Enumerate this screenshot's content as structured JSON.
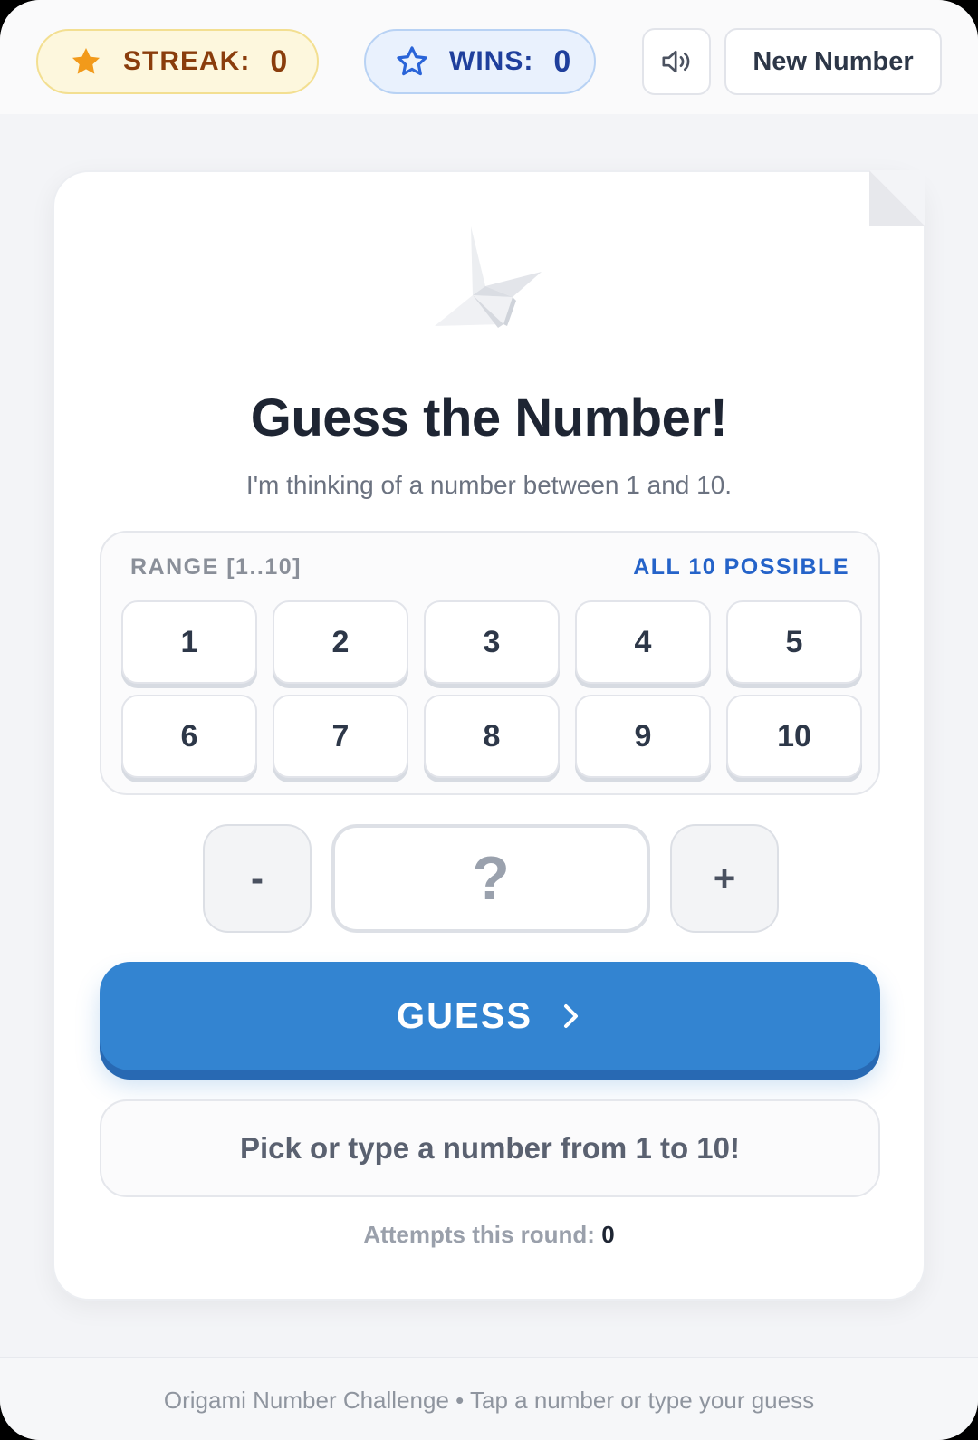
{
  "header": {
    "streak": {
      "label": "STREAK:",
      "value": "0",
      "icon": "star-filled-icon",
      "color": "#f29a1a"
    },
    "wins": {
      "label": "WINS:",
      "value": "0",
      "icon": "star-outline-icon",
      "color": "#2a64d8"
    },
    "sound_icon": "speaker-icon",
    "new_number_label": "New Number"
  },
  "game": {
    "title": "Guess the Number!",
    "subtitle": "I'm thinking of a number between 1 and 10.",
    "range_label": "RANGE [1..10]",
    "range_status": "ALL 10 POSSIBLE",
    "numbers": [
      "1",
      "2",
      "3",
      "4",
      "5",
      "6",
      "7",
      "8",
      "9",
      "10"
    ],
    "minus_label": "-",
    "plus_label": "+",
    "input_placeholder": "?",
    "input_value": "",
    "guess_label": "GUESS",
    "feedback": "Pick or type a number from 1 to 10!",
    "attempts_label": "Attempts this round:",
    "attempts_value": "0",
    "accent_color": "#3384d1"
  },
  "footer": {
    "text": "Origami Number Challenge • Tap a number or type your guess"
  }
}
